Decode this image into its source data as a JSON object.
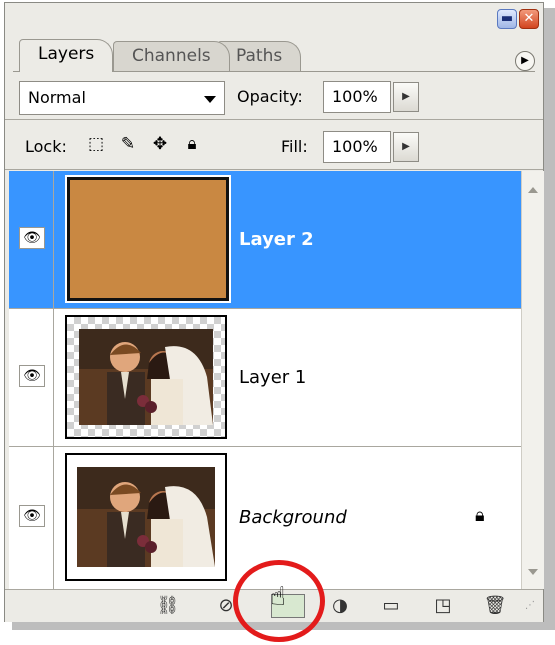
{
  "tabs": [
    {
      "label": "Layers"
    },
    {
      "label": "Channels"
    },
    {
      "label": "Paths"
    }
  ],
  "blend_mode": {
    "value": "Normal"
  },
  "opacity": {
    "label": "Opacity:",
    "value": "100%"
  },
  "lock": {
    "label": "Lock:"
  },
  "fill": {
    "label": "Fill:",
    "value": "100%"
  },
  "layers": [
    {
      "name": "Layer 2",
      "thumbnail": "solid-orange",
      "selected": true
    },
    {
      "name": "Layer 1",
      "thumbnail": "wedding-photo-transparent-edges",
      "selected": false
    },
    {
      "name": "Background",
      "thumbnail": "wedding-photo",
      "selected": false,
      "locked": true
    }
  ],
  "colors": {
    "selection": "#3895ff",
    "layer2_fill": "#c98842",
    "highlight_ring": "#e31b1b"
  },
  "bottom_icons": [
    "link-icon",
    "layer-style-icon",
    "layer-mask-icon",
    "adjustment-layer-icon",
    "folder-icon",
    "new-layer-icon",
    "trash-icon"
  ]
}
